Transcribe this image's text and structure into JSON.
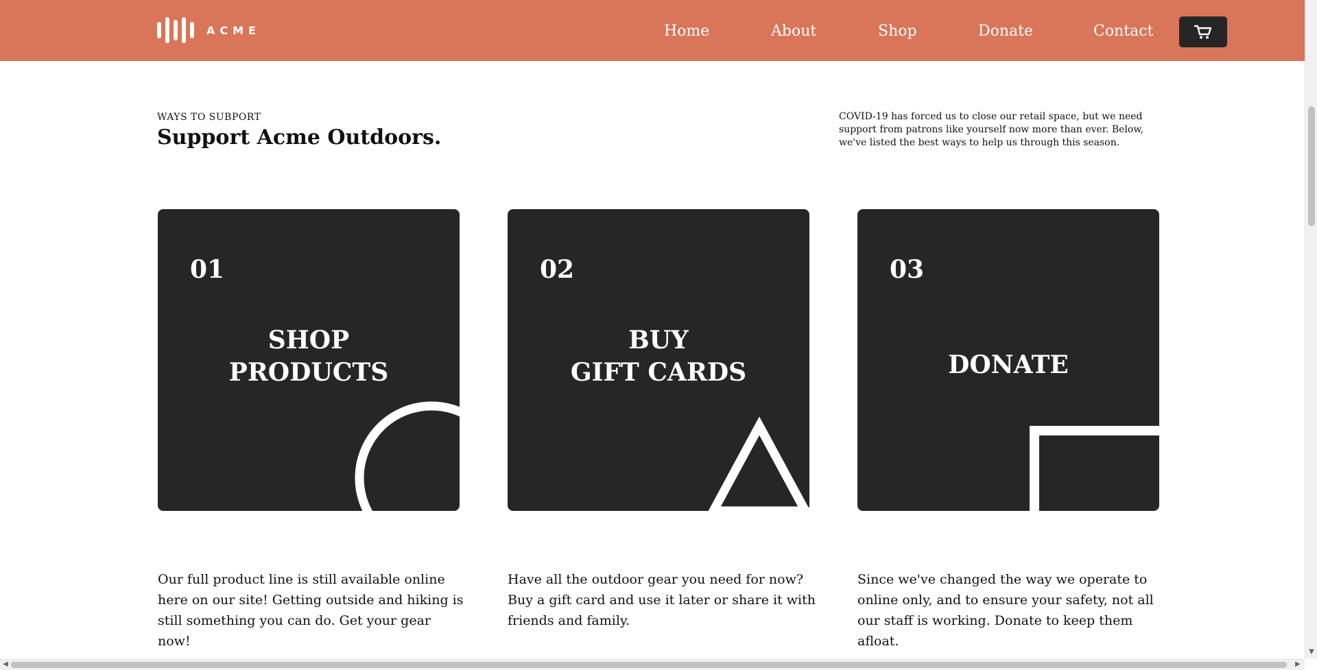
{
  "header": {
    "logo_text": "ACME",
    "nav": [
      "Home",
      "About",
      "Shop",
      "Donate",
      "Contact"
    ],
    "cart_icon": "cart-icon",
    "colors": {
      "background": "#D97558",
      "text": "#FFFFFF",
      "cart_button": "#262626"
    }
  },
  "intro": {
    "eyebrow": "WAYS TO SUBPORT",
    "title": "Support Acme Outdoors.",
    "text": "COVID-19 has forced us to close our retail space, but we need support from patrons like yourself now more than ever. Below, we've listed the best ways to help us through this season."
  },
  "cards": [
    {
      "number": "01",
      "title": "SHOP\nPRODUCTS",
      "shape_icon": "circle-shape-icon",
      "description": "Our full product line is still available online here on our site! Getting outside and hiking is still something you can do. Get your gear now!"
    },
    {
      "number": "02",
      "title": "BUY\nGIFT CARDS",
      "shape_icon": "triangle-shape-icon",
      "description": "Have all the outdoor gear you need for now? Buy a gift card and use it later or share it with friends and family."
    },
    {
      "number": "03",
      "title": "DONATE",
      "shape_icon": "square-shape-icon",
      "description": "Since we've changed the way we operate to online only, and to ensure your safety, not all our staff is working. Donate to keep them afloat."
    }
  ],
  "scrollbars": {
    "vertical": true,
    "horizontal": true
  },
  "colors": {
    "card": "#262626",
    "accent": "#D97558",
    "text": "#111111"
  }
}
